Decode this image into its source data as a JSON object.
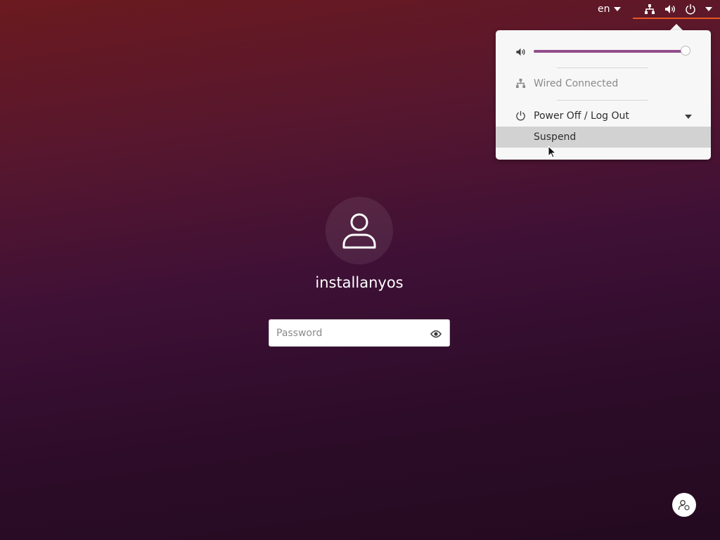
{
  "topbar": {
    "language": "en",
    "indicators": [
      "network-icon",
      "volume-icon",
      "power-icon",
      "menu-arrow-icon"
    ],
    "accent_color": "#e95420"
  },
  "system_menu": {
    "volume": {
      "icon": "volume-icon",
      "level": 1.0,
      "fill_color": "#924d8b"
    },
    "network": {
      "icon": "network-icon",
      "label": "Wired Connected"
    },
    "power": {
      "icon": "power-icon",
      "label": "Power Off / Log Out",
      "expanded": true
    },
    "submenu": [
      {
        "label": "Suspend",
        "highlighted": true
      }
    ]
  },
  "login": {
    "username": "installanyos",
    "password": {
      "placeholder": "Password",
      "value": ""
    },
    "reveal_icon": "eye-icon"
  },
  "accessibility_button": {
    "icon": "accessibility-user-icon"
  }
}
